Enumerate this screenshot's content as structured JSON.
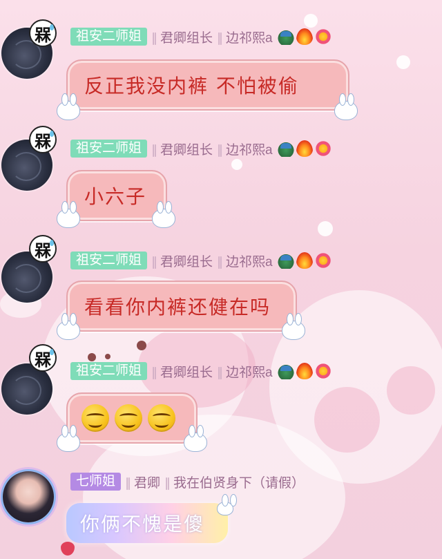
{
  "messages": [
    {
      "avatar_badge": "槑",
      "name_tag": "祖安二师姐",
      "title1": "君卿组长",
      "title2": "边祁熙a",
      "text": "反正我没内裤 不怕被偷"
    },
    {
      "avatar_badge": "槑",
      "name_tag": "祖安二师姐",
      "title1": "君卿组长",
      "title2": "边祁熙a",
      "text": "小六子"
    },
    {
      "avatar_badge": "槑",
      "name_tag": "祖安二师姐",
      "title1": "君卿组长",
      "title2": "边祁熙a",
      "text": "看看你内裤还健在吗"
    },
    {
      "avatar_badge": "槑",
      "name_tag": "祖安二师姐",
      "title1": "君卿组长",
      "title2": "边祁熙a",
      "emoji": [
        "smirk-emoji",
        "smirk-emoji",
        "smirk-emoji"
      ]
    },
    {
      "name_tag": "七师姐",
      "title1": "君卿",
      "title2": "我在伯贤身下（请假）",
      "text": "你俩不愧是傻"
    }
  ],
  "colors": {
    "name_tag_green": "#7fdcb8",
    "name_tag_purple": "#b48ae4",
    "bubble_pink": "#f6b9bb",
    "bubble_text": "#c72a26"
  },
  "icons": [
    "dragon-icon",
    "fire-icon",
    "flower-face-icon"
  ]
}
